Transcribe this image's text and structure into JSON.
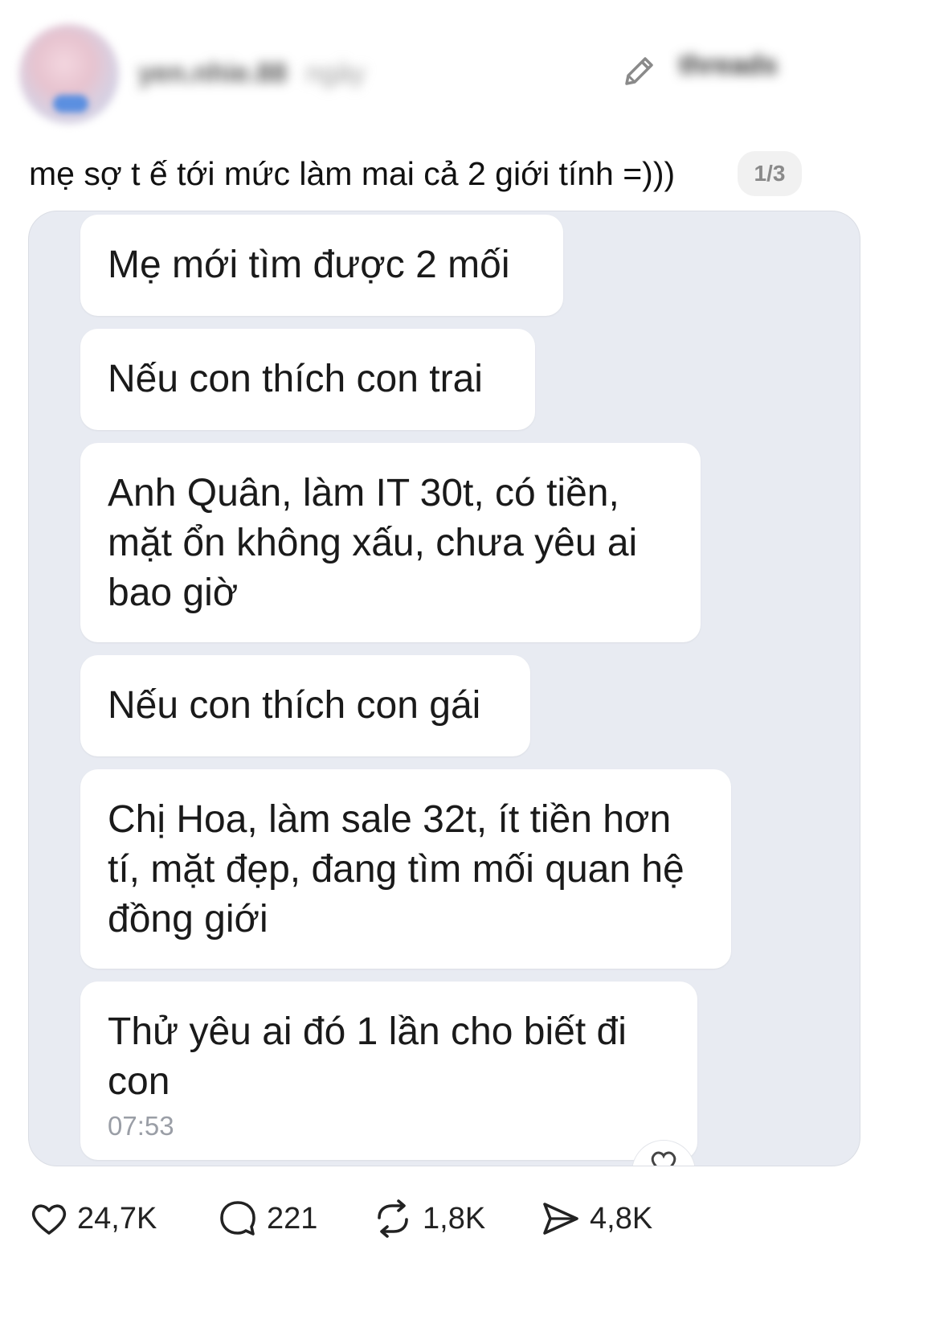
{
  "header": {
    "username": "yen.nhie.88",
    "time_ago": "ngày",
    "edit_icon": "pencil-icon",
    "threads_label": "threads"
  },
  "post": {
    "caption": "mẹ sợ t ế tới mức làm mai cả 2 giới tính =)))",
    "image_counter": "1/3"
  },
  "chat": {
    "messages": [
      "Mẹ mới tìm được 2 mối",
      "Nếu con thích con trai",
      "Anh Quân, làm IT 30t, có tiền, mặt ổn không xấu, chưa yêu ai bao giờ",
      "Nếu con thích con gái",
      "Chị Hoa, làm sale 32t, ít tiền hơn tí, mặt đẹp, đang tìm mối quan hệ đồng giới",
      "Thử yêu ai đó 1 lần cho biết đi con"
    ],
    "last_time": "07:53",
    "bubble_color": "#ffffff",
    "background_color": "#e8ebf2"
  },
  "actions": {
    "likes": "24,7K",
    "comments": "221",
    "reposts": "1,8K",
    "shares": "4,8K"
  }
}
